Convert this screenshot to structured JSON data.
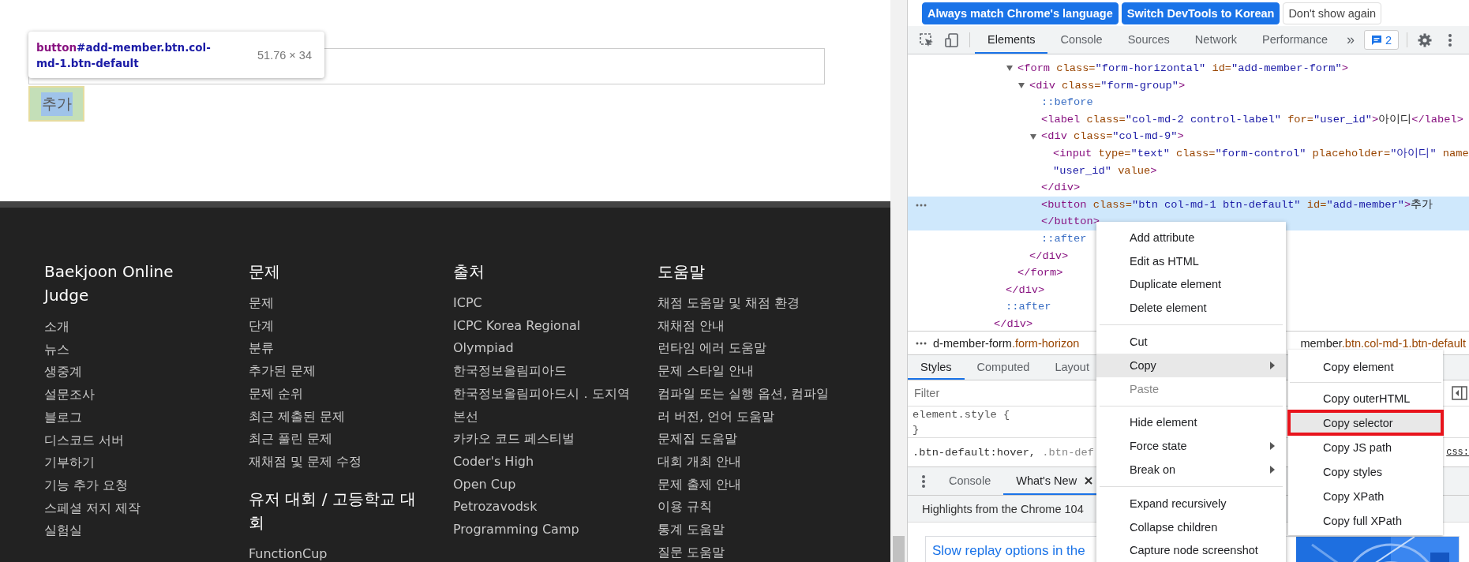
{
  "page": {
    "tooltip": {
      "tag": "button",
      "selector": "#add-member.btn.col-md-1.btn-default",
      "size": "51.76 × 34"
    },
    "add_button": {
      "label": "추가",
      "highlighted": true
    },
    "footer": {
      "columns": [
        {
          "sections": [
            {
              "heading": "Baekjoon Online Judge",
              "items": [
                "소개",
                "뉴스",
                "생중계",
                "설문조사",
                "블로그",
                "디스코드 서버",
                "기부하기",
                "기능 추가 요청",
                "스페셜 저지 제작",
                "실험실"
              ]
            }
          ]
        },
        {
          "sections": [
            {
              "heading": "문제",
              "items": [
                "문제",
                "단계",
                "분류",
                "추가된 문제",
                "문제 순위",
                "최근 제출된 문제",
                "최근 풀린 문제",
                "재채점 및 문제 수정"
              ]
            },
            {
              "heading": "유저 대회 / 고등학교 대회",
              "items": [
                "FunctionCup"
              ]
            }
          ]
        },
        {
          "sections": [
            {
              "heading": "출처",
              "items": [
                "ICPC",
                "ICPC Korea Regional",
                "Olympiad",
                "한국정보올림피아드",
                "한국정보올림피아드시．도지역본선",
                "카카오 코드 페스티벌",
                "Coder's High",
                "Open Cup",
                "Petrozavodsk",
                "Programming Camp"
              ]
            }
          ]
        },
        {
          "sections": [
            {
              "heading": "도움말",
              "items": [
                "채점 도움말 및 채점 환경",
                "재채점 안내",
                "런타임 에러 도움말",
                "문제 스타일 안내",
                "컴파일 또는 실행 옵션, 컴파일러 버전, 언어 도움말",
                "문제집 도움말",
                "대회 개최 안내",
                "문제 출제 안내",
                "이용 규칙",
                "통계 도움말",
                "질문 도움말"
              ]
            }
          ]
        }
      ]
    }
  },
  "devtools": {
    "banner": [
      {
        "label": "Always match Chrome's language",
        "kind": "primary"
      },
      {
        "label": "Switch DevTools to Korean",
        "kind": "primary"
      },
      {
        "label": "Don't show again",
        "kind": "plain"
      }
    ],
    "tabs": [
      {
        "label": "Elements",
        "selected": true
      },
      {
        "label": "Console",
        "selected": false
      },
      {
        "label": "Sources",
        "selected": false
      },
      {
        "label": "Network",
        "selected": false
      },
      {
        "label": "Performance",
        "selected": false
      }
    ],
    "more_tabs": "»",
    "issues": "2",
    "tree": [
      {
        "children": [
          {
            "children": [
              {
                "expanded": true,
                "selected": false,
                "tokens": [
                  {
                    "kind": "tag",
                    "text": "<form"
                  },
                  {
                    "kind": "attr",
                    "text": " class="
                  },
                  {
                    "kind": "value",
                    "text": "\"form-horizontal\""
                  },
                  {
                    "kind": "attr",
                    "text": " id="
                  },
                  {
                    "kind": "value",
                    "text": "\"add-member-form\""
                  },
                  {
                    "kind": "tag",
                    "text": ">"
                  }
                ],
                "children": [
                  {
                    "expanded": true,
                    "selected": false,
                    "tokens": [
                      {
                        "kind": "tag",
                        "text": "<div"
                      },
                      {
                        "kind": "attr",
                        "text": " class="
                      },
                      {
                        "kind": "value",
                        "text": "\"form-group\""
                      },
                      {
                        "kind": "tag",
                        "text": ">"
                      }
                    ],
                    "children": [
                      {
                        "selected": false,
                        "tokens": [
                          {
                            "kind": "pseudo",
                            "text": "::before"
                          }
                        ]
                      },
                      {
                        "selected": false,
                        "tokens": [
                          {
                            "kind": "tag",
                            "text": "<label"
                          },
                          {
                            "kind": "attr",
                            "text": " class="
                          },
                          {
                            "kind": "value",
                            "text": "\"col-md-2 control-label\""
                          },
                          {
                            "kind": "attr",
                            "text": " for="
                          },
                          {
                            "kind": "value",
                            "text": "\"user_id\""
                          },
                          {
                            "kind": "tag",
                            "text": ">"
                          },
                          {
                            "kind": "text",
                            "text": "아이디"
                          },
                          {
                            "kind": "tag",
                            "text": "</label>"
                          }
                        ]
                      },
                      {
                        "expanded": true,
                        "selected": false,
                        "tokens": [
                          {
                            "kind": "tag",
                            "text": "<div"
                          },
                          {
                            "kind": "attr",
                            "text": " class="
                          },
                          {
                            "kind": "value",
                            "text": "\"col-md-9\""
                          },
                          {
                            "kind": "tag",
                            "text": ">"
                          }
                        ],
                        "children": [
                          {
                            "selected": false,
                            "tokens": [
                              {
                                "kind": "tag",
                                "text": "<input"
                              },
                              {
                                "kind": "attr",
                                "text": " type="
                              },
                              {
                                "kind": "value",
                                "text": "\"text\""
                              },
                              {
                                "kind": "attr",
                                "text": " class="
                              },
                              {
                                "kind": "value",
                                "text": "\"form-control\""
                              },
                              {
                                "kind": "attr",
                                "text": " placeholder="
                              },
                              {
                                "kind": "value",
                                "text": "\"아이디\""
                              },
                              {
                                "kind": "attr",
                                "text": " name"
                              }
                            ],
                            "continuation": [
                              {
                                "kind": "value",
                                "text": "\"user_id\""
                              },
                              {
                                "kind": "attr",
                                "text": " value"
                              },
                              {
                                "kind": "tag",
                                "text": ">"
                              }
                            ]
                          }
                        ]
                      },
                      {
                        "selected": false,
                        "tokens": [
                          {
                            "kind": "tag",
                            "text": "</div>"
                          }
                        ]
                      },
                      {
                        "selected": true,
                        "tokens": [
                          {
                            "kind": "tag",
                            "text": "<button"
                          },
                          {
                            "kind": "attr",
                            "text": " class="
                          },
                          {
                            "kind": "value",
                            "text": "\"btn col-md-1 btn-default\""
                          },
                          {
                            "kind": "attr",
                            "text": " id="
                          },
                          {
                            "kind": "value",
                            "text": "\"add-member\""
                          },
                          {
                            "kind": "tag",
                            "text": ">"
                          },
                          {
                            "kind": "text",
                            "text": "추가"
                          }
                        ],
                        "continuation": [
                          {
                            "kind": "tag",
                            "text": "</button>"
                          }
                        ]
                      },
                      {
                        "selected": false,
                        "tokens": [
                          {
                            "kind": "pseudo",
                            "text": "::after"
                          }
                        ]
                      }
                    ]
                  },
                  {
                    "selected": false,
                    "tokens": [
                      {
                        "kind": "tag",
                        "text": "</div>"
                      }
                    ]
                  }
                ]
              },
              {
                "selected": false,
                "tokens": [
                  {
                    "kind": "tag",
                    "text": "</form>"
                  }
                ]
              }
            ]
          },
          {
            "selected": false,
            "tokens": [
              {
                "kind": "tag",
                "text": "</div>"
              }
            ]
          },
          {
            "selected": false,
            "tokens": [
              {
                "kind": "pseudo",
                "text": "::after"
              }
            ]
          }
        ]
      },
      {
        "selected": false,
        "tokens": [
          {
            "kind": "tag",
            "text": "</div>"
          }
        ]
      }
    ],
    "breadcrumb": [
      [
        {
          "kind": "text",
          "text": "d-member-form"
        },
        {
          "kind": "attr",
          "text": ".form-horizon"
        }
      ],
      [
        {
          "kind": "text",
          "text": "member"
        },
        {
          "kind": "attr",
          "text": ".btn.col-md-1.btn-default"
        }
      ]
    ],
    "style_tabs": [
      {
        "label": "Styles",
        "selected": true
      },
      {
        "label": "Computed",
        "selected": false
      },
      {
        "label": "Layout",
        "selected": false
      }
    ],
    "filter": {
      "placeholder": "Filter"
    },
    "element_style": [
      "element.style {",
      "}"
    ],
    "rule": {
      "selector": ".btn-default:hover, ",
      "dimmed": ".btn-def",
      "source": "css:"
    },
    "drawer_tabs": [
      {
        "label": "Console",
        "selected": false,
        "closable": false
      },
      {
        "label": "What's New",
        "selected": true,
        "closable": true
      }
    ],
    "highlights": "Highlights from the Chrome 104",
    "card": {
      "link": "Slow replay options in the"
    },
    "context_menu": [
      {
        "kind": "item",
        "label": "Add attribute",
        "selected": false,
        "disabled": false,
        "submenu": false
      },
      {
        "kind": "item",
        "label": "Edit as HTML",
        "selected": false,
        "disabled": false,
        "submenu": false
      },
      {
        "kind": "item",
        "label": "Duplicate element",
        "selected": false,
        "disabled": false,
        "submenu": false
      },
      {
        "kind": "item",
        "label": "Delete element",
        "selected": false,
        "disabled": false,
        "submenu": false
      },
      {
        "kind": "separator"
      },
      {
        "kind": "item",
        "label": "Cut",
        "selected": false,
        "disabled": false,
        "submenu": false
      },
      {
        "kind": "item",
        "label": "Copy",
        "selected": true,
        "disabled": false,
        "submenu": true
      },
      {
        "kind": "item",
        "label": "Paste",
        "selected": false,
        "disabled": true,
        "submenu": false
      },
      {
        "kind": "separator"
      },
      {
        "kind": "item",
        "label": "Hide element",
        "selected": false,
        "disabled": false,
        "submenu": false
      },
      {
        "kind": "item",
        "label": "Force state",
        "selected": false,
        "disabled": false,
        "submenu": true
      },
      {
        "kind": "item",
        "label": "Break on",
        "selected": false,
        "disabled": false,
        "submenu": true
      },
      {
        "kind": "separator"
      },
      {
        "kind": "item",
        "label": "Expand recursively",
        "selected": false,
        "disabled": false,
        "submenu": false
      },
      {
        "kind": "item",
        "label": "Collapse children",
        "selected": false,
        "disabled": false,
        "submenu": false
      },
      {
        "kind": "item",
        "label": "Capture node screenshot",
        "selected": false,
        "disabled": false,
        "submenu": false
      }
    ],
    "copy_submenu": [
      {
        "kind": "item",
        "label": "Copy element",
        "selected": false,
        "outlined": false
      },
      {
        "kind": "separator"
      },
      {
        "kind": "item",
        "label": "Copy outerHTML",
        "selected": false,
        "outlined": false
      },
      {
        "kind": "item",
        "label": "Copy selector",
        "selected": true,
        "outlined": true
      },
      {
        "kind": "item",
        "label": "Copy JS path",
        "selected": false,
        "outlined": false
      },
      {
        "kind": "item",
        "label": "Copy styles",
        "selected": false,
        "outlined": false
      },
      {
        "kind": "item",
        "label": "Copy XPath",
        "selected": false,
        "outlined": false
      },
      {
        "kind": "item",
        "label": "Copy full XPath",
        "selected": false,
        "outlined": false
      }
    ]
  }
}
